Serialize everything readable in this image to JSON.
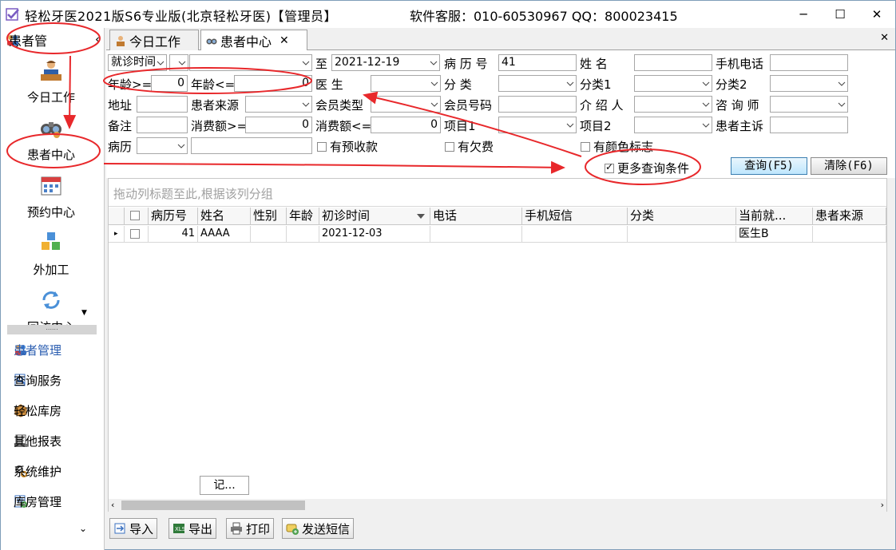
{
  "window": {
    "title": "轻松牙医2021版S6专业版(北京轻松牙医)【管理员】",
    "support": "软件客服：010-60530967 QQ：800023415",
    "min_label": "─",
    "max_label": "☐",
    "close_label": "✕"
  },
  "sidebar": {
    "header": "患者管",
    "collapse_label": "‹",
    "big_items": [
      {
        "label": "今日工作",
        "icon": "doctor-desk-icon"
      },
      {
        "label": "患者中心",
        "icon": "binoculars-icon"
      },
      {
        "label": "预约中心",
        "icon": "calendar-icon"
      },
      {
        "label": "外加工",
        "icon": "cubes-icon"
      },
      {
        "label": "回访中心",
        "icon": "refresh-icon"
      }
    ],
    "scroll_label": "▼",
    "splitter_label": "......",
    "small_items": [
      {
        "label": "患者管理",
        "icon": "people-icon"
      },
      {
        "label": "查询服务",
        "icon": "search-icon"
      },
      {
        "label": "轻松库房",
        "icon": "box-icon"
      },
      {
        "label": "其他报表",
        "icon": "report-icon"
      },
      {
        "label": "系统维护",
        "icon": "gear-icon"
      },
      {
        "label": "库房管理",
        "icon": "warehouse-icon"
      }
    ],
    "more_label": "⌄"
  },
  "tabs": [
    {
      "label": "今日工作",
      "icon": "doctor-icon"
    },
    {
      "label": "患者中心",
      "icon": "binoculars-icon",
      "close": "✕"
    }
  ],
  "tabbar_close": "✕",
  "form": {
    "visit_time": "就诊时间",
    "to_label": "至",
    "to_date": "2021-12-19",
    "record_no_label": "病 历 号",
    "record_no": "41",
    "name_label": "姓    名",
    "phone_label": "手机电话",
    "age_ge_label": "年龄>=",
    "age_ge": "0",
    "age_le_label": "年龄<=",
    "age_le": "0",
    "doctor_label": "医    生",
    "category_label": "分    类",
    "category1_label": "分类1",
    "category2_label": "分类2",
    "address_label": "地址",
    "source_label": "患者来源",
    "member_type_label": "会员类型",
    "member_no_label": "会员号码",
    "referrer_label": "介 绍 人",
    "consultant_label": "咨 询 师",
    "note_label": "备注",
    "spend_ge_label": "消费额>=",
    "spend_ge": "0",
    "spend_le_label": "消费额<=",
    "spend_le": "0",
    "item1_label": "项目1",
    "item2_label": "项目2",
    "complaint_label": "患者主诉",
    "history_label": "病历",
    "prepay_label": "有预收款",
    "debt_label": "有欠费",
    "color_label": "有颜色标志",
    "more_query_label": "更多查询条件",
    "query_btn": "查询(F5)",
    "clear_btn": "清除(F6)"
  },
  "grid": {
    "group_hint": "拖动列标题至此,根据该列分组",
    "columns": [
      "病历号",
      "姓名",
      "性别",
      "年龄",
      "初诊时间",
      "电话",
      "手机短信",
      "分类",
      "当前就...",
      "患者来源"
    ],
    "rows": [
      {
        "record_no": "41",
        "name": "AAAA",
        "gender": "",
        "age": "",
        "first_visit": "2021-12-03",
        "phone": "",
        "sms": "",
        "category": "",
        "current_doctor": "医生B",
        "source": ""
      }
    ],
    "footer_button": "记..."
  },
  "toolbar": {
    "import": "导入",
    "export": "导出",
    "print": "打印",
    "sms": "发送短信"
  },
  "colors": {
    "annotation": "#e8282b",
    "accent": "#2a5db0"
  }
}
